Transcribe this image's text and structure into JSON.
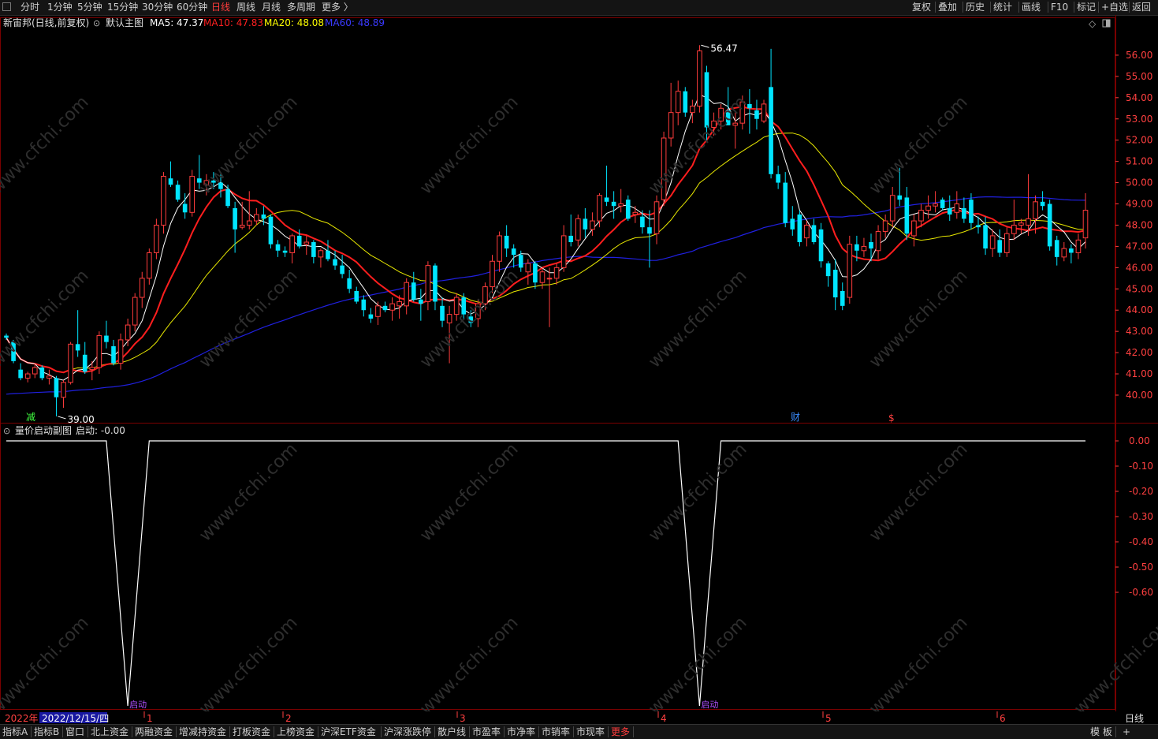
{
  "toolbar": {
    "periods": [
      "分时",
      "1分钟",
      "5分钟",
      "15分钟",
      "30分钟",
      "60分钟",
      "日线",
      "周线",
      "月线",
      "多周期",
      "更多 〉"
    ],
    "active_period": "日线",
    "right_actions": [
      "复权",
      "叠加",
      "历史",
      "统计",
      "画线",
      "F10",
      "标记",
      "+自选",
      "返回"
    ]
  },
  "legend": {
    "stock": "新宙邦(日线,前复权)",
    "template": "默认主图",
    "ma5": "MA5: 47.37",
    "ma10": "MA10: 47.83",
    "ma20": "MA20: 48.08",
    "ma60": "MA60: 48.89"
  },
  "colors": {
    "up": "#ff3c3c",
    "down": "#00e5ff",
    "ma5": "#ffffff",
    "ma10": "#ff1e1e",
    "ma20": "#ffff00",
    "ma60": "#2424ff",
    "grid": "#7a0000",
    "axis_text": "#ff4040",
    "active": "#ff3c3c"
  },
  "main_markers": {
    "high_label": "56.47",
    "low_label": "39.00",
    "reduce": "减",
    "fin": "财",
    "div": "$"
  },
  "sub_legend": {
    "title": "量价启动副图",
    "value": "启动: -0.00"
  },
  "sub_labels": [
    "启动",
    "启动"
  ],
  "date_axis": {
    "year": "2022年",
    "selected_date": "2022/12/15/四",
    "months": [
      "1",
      "2",
      "3",
      "4",
      "5",
      "6"
    ],
    "period_label": "日线"
  },
  "bottom_tabs": [
    "指标A",
    "指标B",
    "窗口",
    "北上资金",
    "两融资金",
    "增减持资金",
    "打板资金",
    "上榜资金",
    "沪深ETF资金",
    "沪深涨跌停",
    "散户线",
    "市盈率",
    "市净率",
    "市销率",
    "市现率",
    "更多"
  ],
  "bottom_right": [
    "模 板",
    "+"
  ],
  "watermark": "www.cfchi.com",
  "chart_data": [
    {
      "type": "candlestick",
      "title": "新宙邦(日线,前复权)",
      "y_ticks": [
        40.0,
        41.0,
        42.0,
        43.0,
        44.0,
        45.0,
        46.0,
        47.0,
        48.0,
        49.0,
        50.0,
        51.0,
        52.0,
        53.0,
        54.0,
        55.0,
        56.0
      ],
      "ylim": [
        39.0,
        56.47
      ],
      "candles": [
        [
          42.8,
          42.9,
          42.6,
          42.7
        ],
        [
          42.5,
          42.6,
          41.5,
          41.6
        ],
        [
          41.2,
          41.5,
          40.7,
          40.8
        ],
        [
          40.8,
          41.1,
          40.6,
          41.0
        ],
        [
          41.0,
          41.5,
          40.8,
          41.3
        ],
        [
          41.3,
          41.4,
          40.7,
          40.8
        ],
        [
          40.8,
          41.2,
          40.5,
          40.9
        ],
        [
          40.8,
          40.9,
          39.0,
          39.9
        ],
        [
          39.9,
          40.7,
          39.4,
          40.6
        ],
        [
          40.6,
          42.5,
          40.5,
          42.4
        ],
        [
          42.4,
          44.0,
          41.8,
          42.1
        ],
        [
          41.9,
          42.5,
          41.0,
          41.1
        ],
        [
          41.2,
          41.6,
          40.7,
          41.3
        ],
        [
          41.3,
          43.0,
          41.0,
          42.8
        ],
        [
          42.8,
          43.5,
          42.2,
          42.5
        ],
        [
          42.3,
          42.6,
          41.4,
          41.5
        ],
        [
          41.5,
          42.9,
          41.2,
          42.6
        ],
        [
          42.6,
          43.6,
          42.3,
          43.3
        ],
        [
          43.3,
          44.8,
          43.0,
          44.6
        ],
        [
          44.6,
          45.8,
          44.1,
          45.5
        ],
        [
          45.5,
          46.9,
          45.2,
          46.7
        ],
        [
          46.7,
          48.3,
          46.4,
          48.0
        ],
        [
          48.0,
          50.5,
          47.6,
          50.3
        ],
        [
          50.2,
          51.0,
          49.8,
          49.9
        ],
        [
          49.9,
          50.1,
          49.1,
          49.2
        ],
        [
          49.0,
          49.5,
          48.3,
          48.6
        ],
        [
          48.6,
          50.6,
          48.4,
          50.3
        ],
        [
          50.2,
          51.3,
          49.7,
          50.0
        ],
        [
          49.9,
          50.4,
          49.4,
          50.1
        ],
        [
          50.1,
          50.5,
          49.7,
          50.0
        ],
        [
          50.0,
          50.5,
          49.3,
          49.7
        ],
        [
          49.7,
          49.9,
          48.8,
          48.9
        ],
        [
          48.8,
          49.1,
          46.7,
          47.8
        ],
        [
          47.9,
          49.1,
          47.8,
          48.0
        ],
        [
          48.0,
          49.6,
          47.8,
          48.2
        ],
        [
          48.2,
          48.8,
          48.0,
          48.5
        ],
        [
          48.5,
          48.9,
          48.0,
          48.3
        ],
        [
          48.4,
          48.5,
          46.9,
          47.1
        ],
        [
          47.1,
          47.3,
          46.5,
          46.8
        ],
        [
          46.8,
          47.0,
          46.5,
          46.7
        ],
        [
          46.7,
          47.6,
          46.2,
          47.5
        ],
        [
          47.5,
          47.8,
          46.9,
          47.0
        ],
        [
          47.1,
          47.5,
          46.6,
          47.2
        ],
        [
          47.2,
          47.3,
          46.2,
          46.5
        ],
        [
          46.5,
          46.9,
          46.0,
          46.8
        ],
        [
          46.8,
          47.3,
          46.3,
          46.4
        ],
        [
          46.4,
          46.8,
          45.9,
          46.1
        ],
        [
          46.1,
          46.6,
          45.5,
          45.7
        ],
        [
          45.5,
          45.9,
          44.8,
          45.0
        ],
        [
          44.9,
          45.1,
          44.3,
          44.4
        ],
        [
          44.5,
          44.7,
          43.7,
          44.0
        ],
        [
          43.8,
          44.1,
          43.4,
          43.6
        ],
        [
          43.7,
          44.4,
          43.3,
          44.2
        ],
        [
          44.2,
          44.4,
          43.9,
          44.0
        ],
        [
          44.0,
          44.6,
          43.5,
          44.3
        ],
        [
          44.2,
          44.7,
          43.6,
          44.4
        ],
        [
          44.2,
          45.5,
          43.8,
          45.3
        ],
        [
          45.3,
          45.8,
          44.4,
          44.5
        ],
        [
          44.5,
          45.0,
          43.5,
          44.3
        ],
        [
          44.4,
          46.3,
          44.0,
          46.1
        ],
        [
          46.1,
          46.2,
          44.0,
          44.4
        ],
        [
          44.2,
          44.6,
          43.2,
          43.5
        ],
        [
          43.4,
          44.2,
          41.5,
          43.8
        ],
        [
          43.8,
          44.8,
          43.5,
          44.6
        ],
        [
          44.6,
          44.8,
          43.6,
          43.8
        ],
        [
          43.7,
          44.0,
          43.2,
          43.4
        ],
        [
          43.6,
          44.5,
          43.2,
          44.3
        ],
        [
          44.3,
          45.3,
          44.0,
          45.1
        ],
        [
          45.1,
          46.6,
          44.8,
          46.3
        ],
        [
          46.3,
          47.7,
          45.8,
          47.5
        ],
        [
          47.5,
          48.0,
          46.5,
          46.9
        ],
        [
          46.9,
          47.1,
          46.0,
          46.6
        ],
        [
          46.6,
          46.8,
          45.8,
          46.0
        ],
        [
          45.8,
          46.4,
          45.2,
          46.2
        ],
        [
          46.2,
          46.3,
          45.0,
          45.3
        ],
        [
          45.3,
          46.0,
          45.0,
          45.8
        ],
        [
          45.5,
          46.0,
          43.2,
          45.5
        ],
        [
          45.5,
          46.2,
          45.2,
          46.0
        ],
        [
          46.0,
          48.0,
          45.8,
          47.5
        ],
        [
          47.5,
          48.5,
          47.0,
          47.2
        ],
        [
          47.3,
          48.5,
          47.0,
          48.3
        ],
        [
          48.3,
          48.8,
          47.4,
          47.8
        ],
        [
          47.8,
          48.6,
          47.5,
          48.2
        ],
        [
          48.2,
          49.5,
          47.9,
          49.4
        ],
        [
          49.3,
          50.8,
          48.9,
          49.1
        ],
        [
          49.1,
          49.6,
          48.3,
          48.9
        ],
        [
          48.9,
          49.7,
          48.6,
          49.0
        ],
        [
          49.2,
          49.4,
          48.2,
          48.3
        ],
        [
          48.5,
          48.9,
          48.1,
          48.6
        ],
        [
          48.4,
          48.7,
          47.6,
          47.9
        ],
        [
          47.9,
          48.7,
          46.0,
          47.6
        ],
        [
          47.6,
          49.4,
          47.1,
          49.1
        ],
        [
          49.2,
          52.4,
          48.9,
          52.1
        ],
        [
          52.1,
          54.7,
          51.7,
          53.3
        ],
        [
          53.3,
          54.8,
          52.7,
          54.3
        ],
        [
          54.3,
          54.5,
          53.1,
          53.3
        ],
        [
          53.3,
          53.9,
          52.8,
          53.6
        ],
        [
          53.6,
          56.47,
          53.3,
          56.2
        ],
        [
          55.2,
          55.5,
          52.0,
          52.6
        ],
        [
          52.6,
          53.3,
          52.2,
          52.9
        ],
        [
          52.9,
          53.7,
          52.5,
          53.5
        ],
        [
          53.4,
          54.5,
          52.7,
          52.7
        ],
        [
          52.7,
          53.3,
          51.6,
          52.8
        ],
        [
          52.8,
          54.1,
          52.5,
          53.8
        ],
        [
          53.7,
          54.4,
          52.3,
          53.5
        ],
        [
          53.4,
          53.9,
          52.5,
          53.0
        ],
        [
          52.9,
          53.9,
          52.8,
          53.7
        ],
        [
          54.5,
          56.3,
          50.2,
          50.4
        ],
        [
          50.4,
          50.8,
          49.7,
          50.0
        ],
        [
          50.0,
          50.5,
          47.9,
          48.1
        ],
        [
          48.3,
          48.9,
          47.5,
          47.8
        ],
        [
          48.5,
          48.7,
          47.0,
          47.2
        ],
        [
          47.4,
          48.2,
          47.0,
          48.0
        ],
        [
          48.0,
          48.3,
          47.1,
          47.2
        ],
        [
          47.8,
          48.1,
          46.0,
          46.3
        ],
        [
          46.2,
          46.3,
          45.1,
          45.6
        ],
        [
          45.9,
          46.4,
          44.0,
          44.6
        ],
        [
          44.9,
          45.3,
          44.0,
          44.2
        ],
        [
          44.6,
          47.5,
          44.3,
          47.1
        ],
        [
          47.1,
          47.5,
          46.3,
          46.8
        ],
        [
          46.8,
          47.4,
          46.5,
          47.0
        ],
        [
          47.2,
          47.6,
          46.3,
          46.9
        ],
        [
          46.8,
          48.0,
          46.4,
          47.7
        ],
        [
          47.7,
          48.5,
          47.4,
          48.2
        ],
        [
          48.2,
          49.8,
          47.9,
          49.4
        ],
        [
          49.4,
          50.7,
          48.9,
          49.2
        ],
        [
          49.3,
          49.8,
          47.3,
          47.6
        ],
        [
          47.5,
          48.5,
          47.0,
          48.2
        ],
        [
          48.2,
          49.0,
          47.9,
          48.7
        ],
        [
          48.7,
          49.4,
          48.3,
          48.9
        ],
        [
          48.9,
          49.6,
          48.6,
          49.0
        ],
        [
          49.2,
          49.3,
          48.7,
          48.8
        ],
        [
          48.8,
          49.4,
          48.2,
          48.5
        ],
        [
          48.6,
          49.6,
          48.3,
          49.0
        ],
        [
          48.8,
          49.3,
          48.1,
          48.3
        ],
        [
          49.2,
          49.5,
          47.8,
          48.1
        ],
        [
          48.0,
          48.4,
          47.6,
          47.9
        ],
        [
          48.0,
          48.4,
          46.6,
          46.9
        ],
        [
          46.9,
          47.8,
          46.5,
          47.5
        ],
        [
          47.3,
          47.8,
          46.5,
          46.7
        ],
        [
          46.7,
          47.9,
          46.5,
          47.6
        ],
        [
          47.6,
          49.2,
          47.3,
          48.0
        ],
        [
          48.0,
          48.3,
          47.6,
          48.1
        ],
        [
          48.0,
          50.4,
          47.5,
          48.3
        ],
        [
          48.3,
          49.4,
          47.6,
          49.1
        ],
        [
          49.1,
          49.6,
          48.7,
          48.9
        ],
        [
          49.0,
          49.2,
          46.8,
          47.0
        ],
        [
          47.3,
          47.5,
          46.1,
          46.5
        ],
        [
          46.5,
          47.2,
          46.3,
          46.9
        ],
        [
          46.9,
          47.1,
          46.2,
          46.7
        ],
        [
          46.7,
          47.6,
          46.4,
          47.3
        ],
        [
          47.4,
          49.5,
          46.9,
          48.7
        ]
      ],
      "ma5": [
        42.2,
        41.6,
        41.2,
        41.2,
        41.1,
        40.9,
        40.9,
        40.6,
        40.6,
        41.0,
        41.4,
        41.7,
        41.9,
        42.1,
        42.4,
        42.3,
        42.4,
        42.8,
        43.3,
        44.2,
        45.0,
        45.8,
        46.9,
        47.8,
        48.6,
        49.1,
        49.4,
        49.7,
        49.9,
        50.0,
        49.8,
        49.6,
        49.3,
        48.9,
        48.6,
        48.4,
        48.3,
        47.9,
        47.6,
        47.3,
        47.1,
        47.0,
        47.0,
        46.9,
        46.9,
        46.8,
        46.6,
        46.3,
        45.9,
        45.6,
        45.2,
        44.7,
        44.3,
        43.9,
        43.9,
        44.0,
        44.3,
        44.5,
        44.5,
        44.8,
        44.9,
        44.9,
        44.8,
        44.6,
        44.4,
        44.0,
        43.9,
        44.1,
        44.5,
        45.2,
        45.9,
        46.4,
        46.7,
        46.8,
        46.6,
        46.2,
        45.8,
        45.7,
        46.0,
        46.2,
        46.7,
        47.1,
        47.3,
        47.6,
        48.0,
        48.4,
        48.6,
        48.6,
        48.6,
        48.6,
        48.3,
        48.4,
        49.2,
        50.1,
        51.2,
        52.4,
        53.1,
        53.9,
        54.1,
        53.8,
        53.6,
        53.3,
        53.1,
        53.0,
        53.2,
        53.2,
        53.2,
        52.5,
        51.9,
        51.1,
        50.3,
        49.5,
        48.5,
        48.0,
        47.6,
        47.0,
        46.4,
        45.9,
        45.8,
        45.9,
        46.0,
        46.3,
        46.6,
        46.9,
        47.3,
        47.7,
        48.2,
        48.3,
        48.4,
        48.6,
        48.6,
        48.6,
        48.7,
        48.8,
        48.7,
        48.5,
        48.4,
        48.0,
        47.9,
        47.6,
        47.4,
        47.4,
        47.6,
        47.7,
        47.9,
        48.1,
        48.5,
        48.4,
        48.1,
        48.0,
        47.9,
        47.6,
        47.4
      ]
    },
    {
      "type": "line",
      "title": "量价启动副图",
      "y_ticks": [
        0.0,
        -0.1,
        -0.2,
        -0.3,
        -0.4,
        -0.5,
        -0.6
      ],
      "ylim": [
        -1.0,
        0.0
      ],
      "series": [
        {
          "name": "启动",
          "spikes": [
            {
              "index": 17,
              "value": -1.0
            },
            {
              "index": 97,
              "value": -1.0
            }
          ],
          "baseline": 0.0
        }
      ]
    }
  ]
}
